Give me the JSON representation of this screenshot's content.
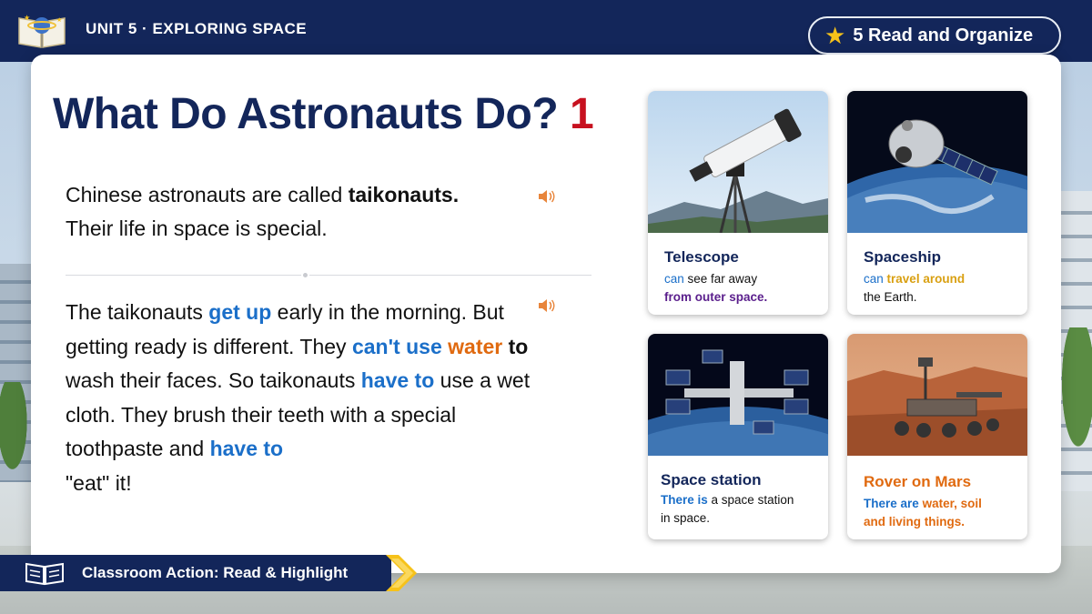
{
  "header": {
    "unit_title": "UNIT 5 · EXPLORING SPACE",
    "badge_label": "5 Read and Organize"
  },
  "lesson": {
    "title": "What Do Astronauts Do?",
    "title_number": "1",
    "para1": {
      "t1": "Chinese astronauts are called ",
      "k1": "taikonauts.",
      "t2": "Their life in space is special."
    },
    "para2": {
      "t1": "The taikonauts ",
      "k1": "get up",
      "t2": " early in the morning. But getting ready is different. They ",
      "k2": "can't use",
      "k3": "water",
      "k4": "to",
      "t3": " wash their faces. So taikonauts ",
      "k5": "have to",
      "t4": " use a wet cloth. They brush their teeth with a special toothpaste and ",
      "k6": "have to",
      "t5": "\"eat\" it!"
    }
  },
  "picture_cards": [
    {
      "name": "Telescope",
      "d1": "can",
      "d2": " see far away",
      "d3": "from outer space."
    },
    {
      "name": "Spaceship",
      "d1": "can",
      "d2": "travel around",
      "d3": "the Earth."
    },
    {
      "name": "Space station",
      "d1": "There is",
      "d2": " a space station",
      "d3": "in space."
    },
    {
      "name": "Rover on Mars",
      "d1": "There are",
      "d2": "water, soil",
      "d3": "and",
      "d4": "living things."
    }
  ],
  "footer": {
    "action_label": "Classroom Action: Read & Highlight"
  },
  "colors": {
    "navy": "#13265a",
    "title_red": "#c7111f",
    "keyword_blue": "#1b6fc9",
    "keyword_orange": "#e06a10",
    "star_gold": "#f6c21a"
  },
  "icons": [
    "book-planet-icon",
    "star-icon",
    "speaker-icon",
    "open-book-icon",
    "chevron-right-icon"
  ]
}
